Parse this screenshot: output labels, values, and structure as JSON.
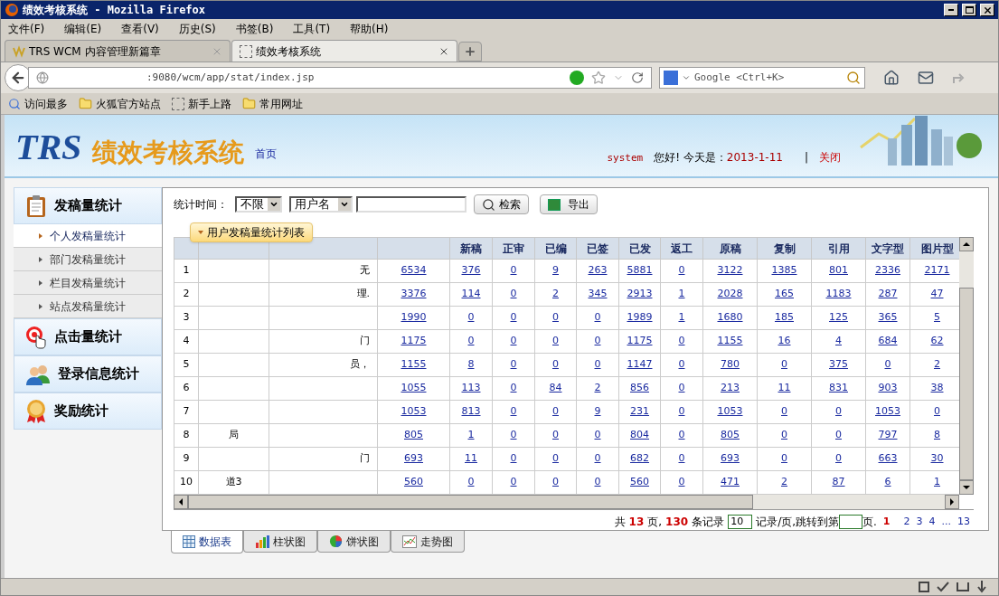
{
  "window": {
    "title": "绩效考核系统 - Mozilla Firefox"
  },
  "menu": [
    "文件(F)",
    "编辑(E)",
    "查看(V)",
    "历史(S)",
    "书签(B)",
    "工具(T)",
    "帮助(H)"
  ],
  "browser_tabs": [
    {
      "label": "TRS WCM 内容管理新篇章",
      "selected": false
    },
    {
      "label": "绩效考核系统",
      "selected": true
    }
  ],
  "address": {
    "value": ":9080/wcm/app/stat/index.jsp"
  },
  "search": {
    "placeholder": "Google <Ctrl+K>"
  },
  "bookmarks": [
    "访问最多",
    "火狐官方站点",
    "新手上路",
    "常用网址"
  ],
  "banner": {
    "logo": "TRS",
    "title": "绩效考核系统",
    "home_link": "首页",
    "user": "system",
    "greeting": "您好! 今天是：",
    "date": "2013-1-11",
    "separator": "|",
    "close_link": "关闭"
  },
  "sidebar": [
    {
      "label": "发稿量统计",
      "items": [
        {
          "label": "个人发稿量统计",
          "selected": true
        },
        {
          "label": "部门发稿量统计",
          "selected": false
        },
        {
          "label": "栏目发稿量统计",
          "selected": false
        },
        {
          "label": "站点发稿量统计",
          "selected": false
        }
      ]
    },
    {
      "label": "点击量统计"
    },
    {
      "label": "登录信息统计"
    },
    {
      "label": "奖励统计"
    }
  ],
  "filter": {
    "label": "统计时间：",
    "period": "不限",
    "field": "用户名",
    "search_button": "检索",
    "export_button": "导出"
  },
  "list_title": "用户发稿量统计列表",
  "table": {
    "columns": [
      "新稿",
      "正审",
      "已编",
      "已签",
      "已发",
      "返工",
      "原稿",
      "复制",
      "引用",
      "文字型",
      "图片型"
    ],
    "rows": [
      {
        "no": "1",
        "dept": "无",
        "values": [
          "6534",
          "376",
          "0",
          "9",
          "263",
          "5881",
          "0",
          "3122",
          "1385",
          "801",
          "2336",
          "2171"
        ]
      },
      {
        "no": "2",
        "dept": "理.",
        "values": [
          "3376",
          "114",
          "0",
          "2",
          "345",
          "2913",
          "1",
          "2028",
          "165",
          "1183",
          "287",
          "47"
        ]
      },
      {
        "no": "3",
        "values": [
          "1990",
          "0",
          "0",
          "0",
          "0",
          "1989",
          "1",
          "1680",
          "185",
          "125",
          "365",
          "5"
        ]
      },
      {
        "no": "4",
        "dept": "门",
        "values": [
          "1175",
          "0",
          "0",
          "0",
          "0",
          "1175",
          "0",
          "1155",
          "16",
          "4",
          "684",
          "62"
        ]
      },
      {
        "no": "5",
        "dept": "员，",
        "values": [
          "1155",
          "8",
          "0",
          "0",
          "0",
          "1147",
          "0",
          "780",
          "0",
          "375",
          "0",
          "2"
        ]
      },
      {
        "no": "6",
        "values": [
          "1055",
          "113",
          "0",
          "84",
          "2",
          "856",
          "0",
          "213",
          "11",
          "831",
          "903",
          "38"
        ]
      },
      {
        "no": "7",
        "values": [
          "1053",
          "813",
          "0",
          "0",
          "9",
          "231",
          "0",
          "1053",
          "0",
          "0",
          "1053",
          "0"
        ]
      },
      {
        "no": "8",
        "name": "局",
        "values": [
          "805",
          "1",
          "0",
          "0",
          "0",
          "804",
          "0",
          "805",
          "0",
          "0",
          "797",
          "8"
        ]
      },
      {
        "no": "9",
        "dept": "门",
        "values": [
          "693",
          "11",
          "0",
          "0",
          "0",
          "682",
          "0",
          "693",
          "0",
          "0",
          "663",
          "30"
        ]
      },
      {
        "no": "10",
        "name": "道3",
        "values": [
          "560",
          "0",
          "0",
          "0",
          "0",
          "560",
          "0",
          "471",
          "2",
          "87",
          "6",
          "1"
        ]
      }
    ]
  },
  "pagination": {
    "prefix": "共",
    "pages": "13",
    "pages_suffix": "页,",
    "records": "130",
    "records_suffix": "条记录",
    "per_page": "10",
    "per_page_suffix": "记录/页,跳转到第",
    "goto_suffix": "页.",
    "links": [
      {
        "label": "1",
        "selected": true
      },
      {
        "label": "2",
        "selected": false
      },
      {
        "label": "3",
        "selected": false
      },
      {
        "label": "4",
        "selected": false
      },
      {
        "label": "...",
        "selected": false
      },
      {
        "label": "13",
        "selected": false
      }
    ]
  },
  "view_tabs": [
    {
      "label": "数据表",
      "selected": true
    },
    {
      "label": "柱状图",
      "selected": false
    },
    {
      "label": "饼状图",
      "selected": false
    },
    {
      "label": "走势图",
      "selected": false
    }
  ]
}
